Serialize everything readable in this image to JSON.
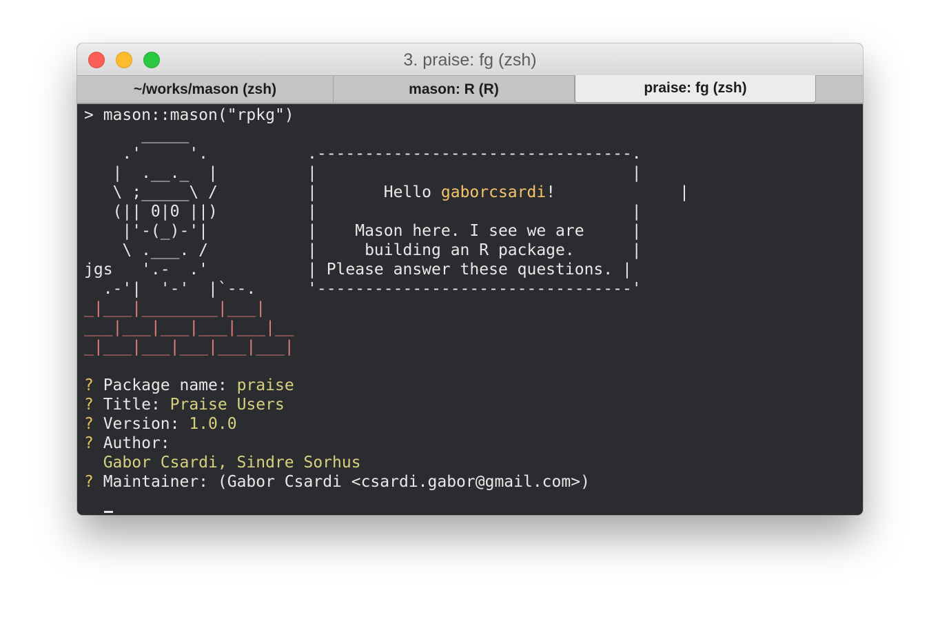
{
  "window": {
    "title": "3. praise: fg (zsh)",
    "traffic_lights": [
      "close",
      "minimize",
      "zoom"
    ]
  },
  "tabs": [
    {
      "label": "~/works/mason (zsh)",
      "active": false
    },
    {
      "label": "mason: R (R)",
      "active": false
    },
    {
      "label": "praise: fg (zsh)",
      "active": true
    }
  ],
  "colors": {
    "terminal_bg": "#2b2c30",
    "text": "#e8e8e8",
    "brick": "#e07d78",
    "question_mark": "#e8c15c",
    "answer": "#d7d17f",
    "username": "#f5c36a"
  },
  "terminal": {
    "command": "> mason::mason(\"rpkg\")",
    "art": [
      "      _____                  .---------------------------------.",
      "    .'     '.                |                                 |",
      "    |  .__._  |               |       Hello ",
      "    \\ ;_____\\ /               |                                 |",
      "    (|| 0|0 ||)               |    Mason here. I see we are     |",
      "     |'-(_)-'|                |     building an R package.      |",
      "      \\ .___. /               | Please answer these questions. |",
      "jgs    '.-  .'               '---------------------------------'",
      "  .-'|  '-'  |`--."
    ],
    "greeting_prefix": "       Hello ",
    "greeting_user": "gaborcsardi",
    "greeting_suffix": "!",
    "bricks": [
      "_|___|________|___|",
      "___|___|___|___|___|__",
      "_|___|___|___|___|___|"
    ],
    "prompts": [
      {
        "mark": "?",
        "label": " Package name: ",
        "answer": "praise"
      },
      {
        "mark": "?",
        "label": " Title: ",
        "answer": "Praise Users"
      },
      {
        "mark": "?",
        "label": " Version: ",
        "answer": "1.0.0"
      },
      {
        "mark": "?",
        "label": " Author:",
        "answer": ""
      }
    ],
    "author_answer": "  Gabor Csardi, Sindre Sorhus",
    "maintainer_prompt": {
      "mark": "?",
      "label": " Maintainer: (Gabor Csardi <csardi.gabor@gmail.com>)"
    }
  }
}
